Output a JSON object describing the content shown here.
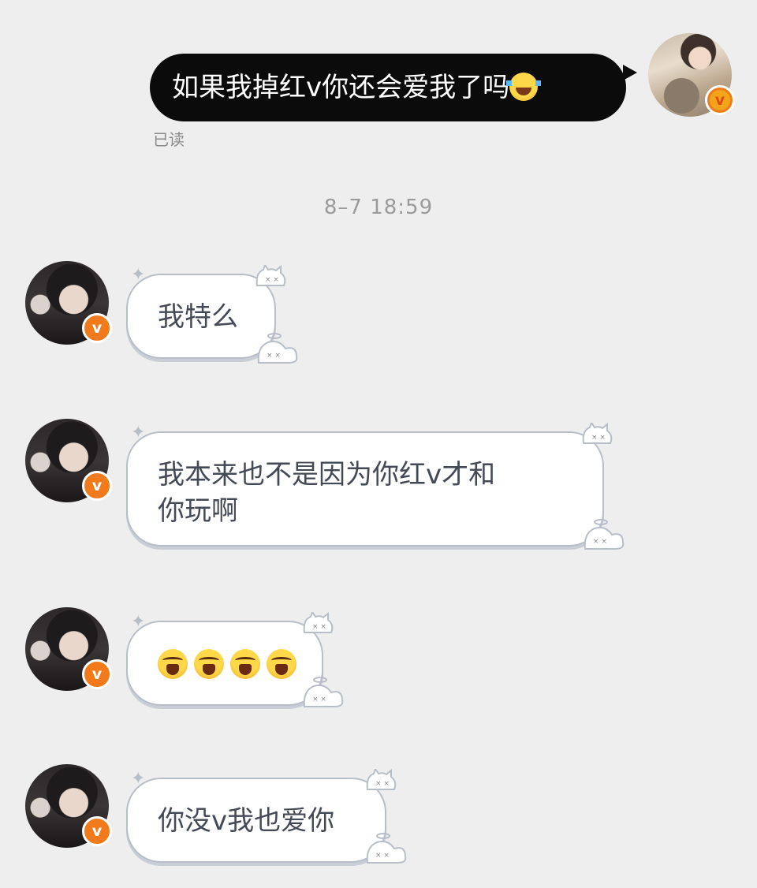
{
  "sent_message": {
    "text": "如果我掉红v你还会爱我了吗",
    "emoji": "laughing-crying-emoji",
    "status": "已读"
  },
  "timestamp": "8–7 18:59",
  "received_messages": [
    {
      "text": "我特么"
    },
    {
      "text_line1": "我本来也不是因为你红v才和",
      "text_line2": "你玩啊"
    },
    {
      "emojis": [
        "angry-shouting-emoji",
        "angry-shouting-emoji",
        "angry-shouting-emoji",
        "angry-shouting-emoji"
      ]
    },
    {
      "text": "你没v我也爱你"
    }
  ],
  "badge": {
    "label": "v"
  },
  "colors": {
    "background": "#eeeeef",
    "sent_bubble": "#0b0b0b",
    "received_bubble": "#ffffff",
    "received_border": "#b8bec8",
    "verified_badge": "#f27a1a"
  }
}
